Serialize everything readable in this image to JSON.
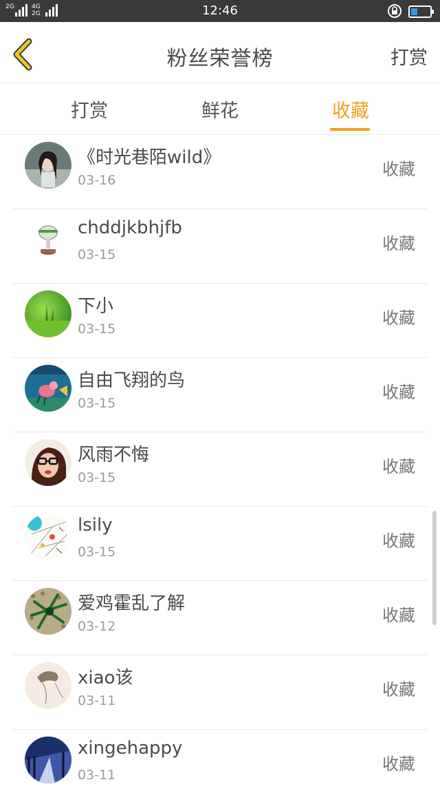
{
  "status_bar": {
    "network_1": "2G",
    "network_2": "4G",
    "network_3": "2G",
    "time": "12:46"
  },
  "header": {
    "title": "粉丝荣誉榜",
    "right_action": "打赏"
  },
  "tabs": [
    {
      "label": "打赏",
      "active": false
    },
    {
      "label": "鲜花",
      "active": false
    },
    {
      "label": "收藏",
      "active": true
    }
  ],
  "colors": {
    "accent": "#f0a31e",
    "text": "#4a4a4a",
    "muted": "#9a9a9a"
  },
  "items": [
    {
      "name": "《时光巷陌wild》",
      "date": "03-16",
      "action": "收藏",
      "avatar": "girl-portrait-avatar"
    },
    {
      "name": "chddjkbhjfb",
      "date": "03-15",
      "action": "收藏",
      "avatar": "trophy-cup-avatar"
    },
    {
      "name": "下小",
      "date": "03-15",
      "action": "收藏",
      "avatar": "green-grass-avatar"
    },
    {
      "name": "自由飞翔的鸟",
      "date": "03-15",
      "action": "收藏",
      "avatar": "cartoon-bird-avatar"
    },
    {
      "name": "风雨不悔",
      "date": "03-15",
      "action": "收藏",
      "avatar": "glasses-girl-avatar"
    },
    {
      "name": "lsily",
      "date": "03-15",
      "action": "收藏",
      "avatar": "sketch-avatar"
    },
    {
      "name": "爱鸡霍乱了解",
      "date": "03-12",
      "action": "收藏",
      "avatar": "green-ornament-avatar"
    },
    {
      "name": "xiao该",
      "date": "03-11",
      "action": "收藏",
      "avatar": "ink-drawing-avatar"
    },
    {
      "name": "xingehappy",
      "date": "03-11",
      "action": "收藏",
      "avatar": "night-road-avatar"
    }
  ]
}
